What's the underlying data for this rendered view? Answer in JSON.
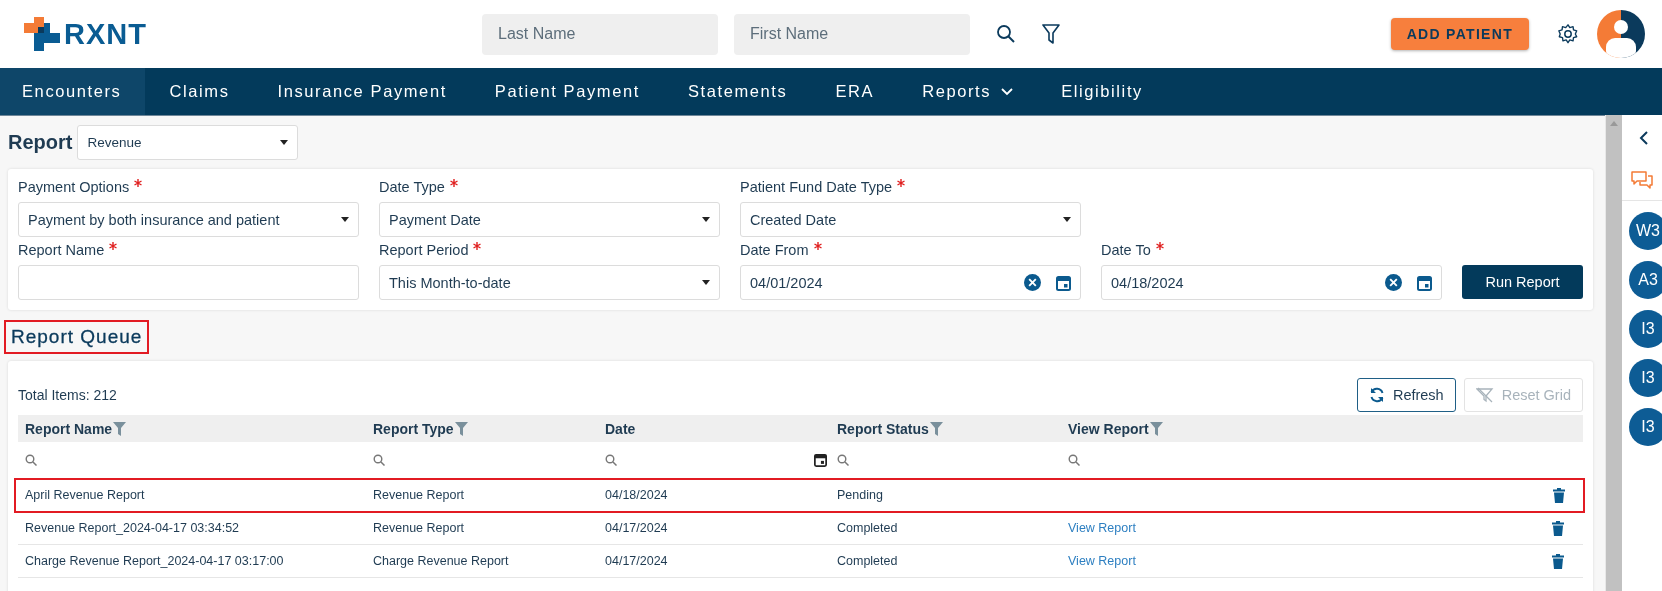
{
  "header": {
    "logo": "RXNT",
    "search_fields": [
      {
        "placeholder": "Last Name"
      },
      {
        "placeholder": "First Name"
      }
    ],
    "add_button": "ADD PATIENT"
  },
  "nav": [
    {
      "label": "Encounters",
      "selected": true,
      "dropdown": false
    },
    {
      "label": "Claims",
      "selected": false,
      "dropdown": false
    },
    {
      "label": "Insurance Payment",
      "selected": false,
      "dropdown": false
    },
    {
      "label": "Patient Payment",
      "selected": false,
      "dropdown": false
    },
    {
      "label": "Statements",
      "selected": false,
      "dropdown": false
    },
    {
      "label": "ERA",
      "selected": false,
      "dropdown": false
    },
    {
      "label": "Reports",
      "selected": false,
      "dropdown": true
    },
    {
      "label": "Eligibility",
      "selected": false,
      "dropdown": false
    }
  ],
  "report_select": {
    "label": "Report",
    "value": "Revenue"
  },
  "form": {
    "rows": [
      [
        {
          "label": "Payment Options",
          "required": true,
          "kind": "select",
          "value": "Payment by both insurance and patient"
        },
        {
          "label": "Date Type",
          "required": true,
          "kind": "select",
          "value": "Payment Date"
        },
        {
          "label": "Patient Fund Date Type",
          "required": true,
          "kind": "select",
          "value": "Created Date"
        }
      ],
      [
        {
          "label": "Report Name",
          "required": true,
          "kind": "text"
        },
        {
          "label": "Report Period",
          "required": true,
          "kind": "select",
          "value": "This Month-to-date"
        },
        {
          "label": "Date From",
          "required": true,
          "kind": "date",
          "value": "04/01/2024"
        },
        {
          "label": "Date To",
          "required": true,
          "kind": "date",
          "value": "04/18/2024"
        }
      ]
    ],
    "run_button": "Run Report"
  },
  "queue": {
    "title": "Report Queue",
    "title_highlighted": true,
    "total": "Total Items: 212",
    "buttons": [
      {
        "label": "Refresh",
        "kind": "refresh",
        "disabled": false
      },
      {
        "label": "Reset Grid",
        "kind": "reset",
        "disabled": true
      }
    ],
    "columns": [
      {
        "label": "Report Name",
        "filter": true,
        "kind": "text"
      },
      {
        "label": "Report Type",
        "filter": true,
        "kind": "text"
      },
      {
        "label": "Date",
        "filter": false,
        "kind": "date"
      },
      {
        "label": "Report Status",
        "filter": true,
        "kind": "text"
      },
      {
        "label": "View Report",
        "filter": true,
        "kind": "text"
      }
    ],
    "rows": [
      {
        "highlighted": true,
        "cells": [
          "April Revenue Report",
          "Revenue Report",
          "04/18/2024",
          "Pending"
        ]
      },
      {
        "highlighted": false,
        "cells": [
          "Revenue Report_2024-04-17 03:34:52",
          "Revenue Report",
          "04/17/2024",
          "Completed"
        ],
        "link": "View Report"
      },
      {
        "highlighted": false,
        "cells": [
          "Charge Revenue Report_2024-04-17 03:17:00",
          "Charge Revenue Report",
          "04/17/2024",
          "Completed"
        ],
        "link": "View Report"
      }
    ]
  },
  "sidebar": {
    "badges": [
      "W3",
      "A3",
      "I3",
      "I3",
      "I3"
    ]
  }
}
